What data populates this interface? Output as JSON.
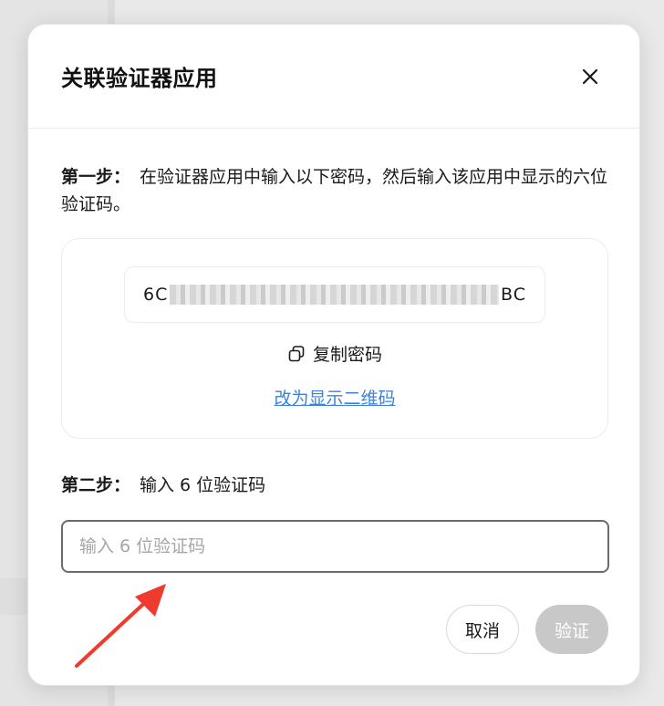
{
  "modal": {
    "title": "关联验证器应用",
    "step1": {
      "label": "第一步：",
      "text": "在验证器应用中输入以下密码，然后输入该应用中显示的六位验证码。"
    },
    "secret": {
      "visible_start": "6C",
      "visible_end": "BC"
    },
    "copy_label": "复制密码",
    "qr_link": "改为显示二维码",
    "step2": {
      "label": "第二步：",
      "text": "输入 6 位验证码"
    },
    "code_input": {
      "placeholder": "输入 6 位验证码",
      "value": ""
    },
    "buttons": {
      "cancel": "取消",
      "verify": "验证"
    }
  },
  "colors": {
    "link": "#3b82d8",
    "verify_disabled": "#c8c8c8",
    "annotation_arrow": "#ee3b2e"
  },
  "icons": {
    "close": "close-icon",
    "copy": "copy-icon",
    "annotation": "red-arrow-annotation"
  }
}
